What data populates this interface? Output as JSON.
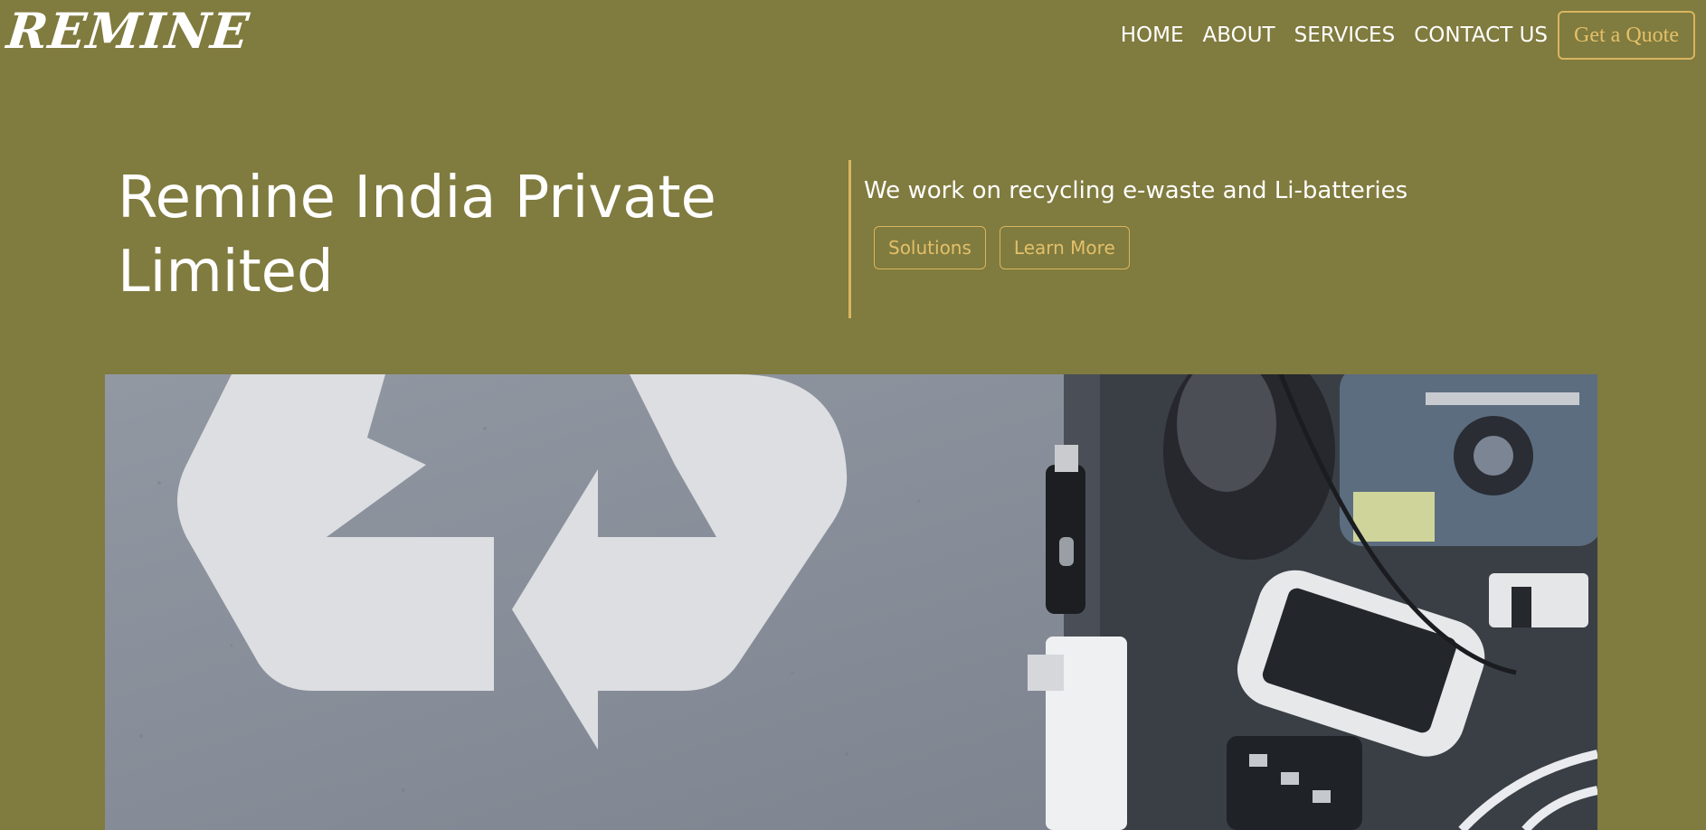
{
  "nav": {
    "logo": "REMINE",
    "links": [
      "HOME",
      "ABOUT",
      "SERVICES",
      "CONTACT US"
    ],
    "quote_label": "Get a Quote"
  },
  "hero": {
    "title": "Remine India Private Limited",
    "tagline": "We work on recycling e-waste and Li-batteries",
    "buttons": [
      "Solutions",
      "Learn More"
    ]
  },
  "colors": {
    "background": "#807b3e",
    "accent": "#d9b560",
    "text": "#ffffff"
  },
  "image": {
    "subject": "recycle-symbol-and-electronic-waste"
  }
}
